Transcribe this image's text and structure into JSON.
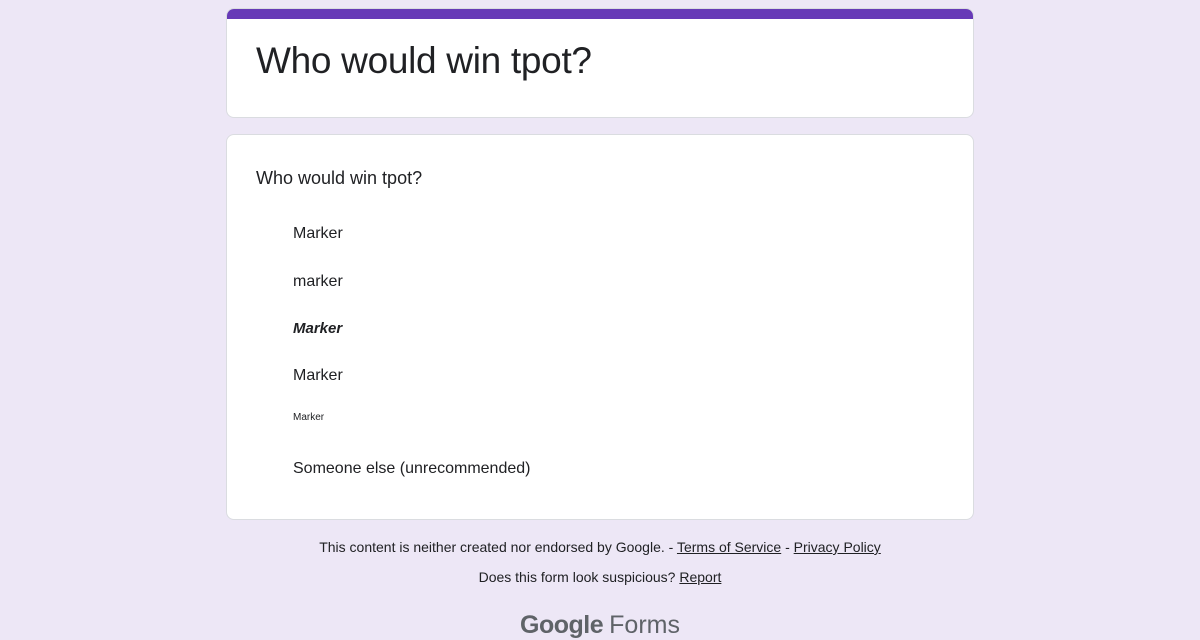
{
  "form": {
    "title": "Who would win tpot?",
    "accent_color": "#673ab7",
    "background_color": "#ede7f6"
  },
  "question": {
    "title": "Who would win tpot?",
    "options": [
      "Marker",
      "marker",
      "Marker",
      "Marker",
      "Marker",
      "Someone else (unrecommended)"
    ]
  },
  "footer": {
    "disclaimer": "This content is neither created nor endorsed by Google.",
    "sep1": " - ",
    "terms_label": "Terms of Service",
    "sep2": " - ",
    "privacy_label": "Privacy Policy",
    "suspicious_text": "Does this form look suspicious?",
    "report_label": "Report"
  },
  "brand": {
    "google": "Google",
    "forms": "Forms"
  }
}
